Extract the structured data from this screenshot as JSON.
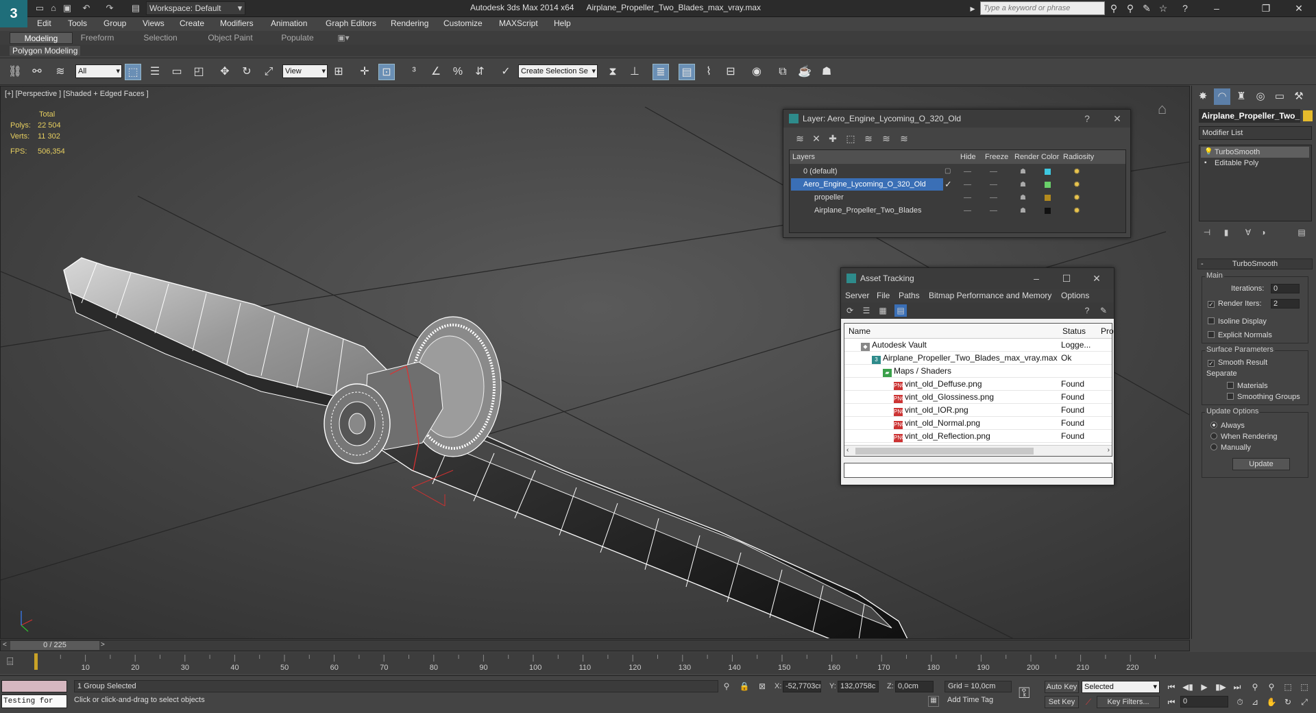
{
  "title_bar": {
    "logo": "3",
    "workspace": "Workspace: Default",
    "app_title": "Autodesk 3ds Max  2014 x64",
    "file_name": "Airplane_Propeller_Two_Blades_max_vray.max",
    "search_placeholder": "Type a keyword or phrase"
  },
  "menu": [
    "Edit",
    "Tools",
    "Group",
    "Views",
    "Create",
    "Modifiers",
    "Animation",
    "Graph Editors",
    "Rendering",
    "Customize",
    "MAXScript",
    "Help"
  ],
  "ribbon": {
    "tabs": [
      "Modeling",
      "Freeform",
      "Selection",
      "Object Paint",
      "Populate"
    ],
    "active_tab": "Modeling",
    "panel_label": "Polygon Modeling"
  },
  "toolbar": {
    "filter": "All",
    "ref_coord": "View",
    "selection_set": "Create Selection Se"
  },
  "viewport": {
    "label": "[+] [Perspective ] [Shaded + Edged Faces ]",
    "stats": {
      "header": "Total",
      "polys_label": "Polys:",
      "polys": "22 504",
      "verts_label": "Verts:",
      "verts": "11 302",
      "fps_label": "FPS:",
      "fps": "506,354"
    }
  },
  "layer_dialog": {
    "title": "Layer: Aero_Engine_Lycoming_O_320_Old",
    "columns": [
      "Layers",
      "Hide",
      "Freeze",
      "Render",
      "Color",
      "Radiosity"
    ],
    "rows": [
      {
        "name": "0 (default)",
        "color": "#3ec8e0"
      },
      {
        "name": "Aero_Engine_Lycoming_O_320_Old",
        "color": "#6ad06a"
      },
      {
        "name": "propeller",
        "color": "#b38a1d"
      },
      {
        "name": "Airplane_Propeller_Two_Blades",
        "color": "#111111"
      }
    ],
    "selected_row": "Aero_Engine_Lycoming_O_320_Old"
  },
  "asset_dialog": {
    "title": "Asset Tracking",
    "menu": [
      "Server",
      "File",
      "Paths",
      "Bitmap Performance and Memory",
      "Options"
    ],
    "columns": [
      "Name",
      "Status",
      "Pro"
    ],
    "rows": [
      {
        "name": "Autodesk Vault",
        "status": "Logge..."
      },
      {
        "name": "Airplane_Propeller_Two_Blades_max_vray.max",
        "status": "Ok"
      },
      {
        "name": "Maps / Shaders",
        "status": ""
      },
      {
        "name": "vint_old_Deffuse.png",
        "status": "Found"
      },
      {
        "name": "vint_old_Glossiness.png",
        "status": "Found"
      },
      {
        "name": "vint_old_IOR.png",
        "status": "Found"
      },
      {
        "name": "vint_old_Normal.png",
        "status": "Found"
      },
      {
        "name": "vint_old_Reflection.png",
        "status": "Found"
      }
    ],
    "png_label": "PNG"
  },
  "command_panel": {
    "object_name": "Airplane_Propeller_Two_",
    "object_color": "#e6bb2c",
    "modifier_list": "Modifier List",
    "stack": [
      "TurboSmooth",
      "Editable Poly"
    ],
    "turbosmooth": {
      "title": "TurboSmooth",
      "main": "Main",
      "iterations_label": "Iterations:",
      "iterations": "0",
      "render_iters_label": "Render Iters:",
      "render_iters": "2",
      "isoline": "Isoline Display",
      "explicit": "Explicit Normals",
      "surface_params": "Surface Parameters",
      "smooth_result": "Smooth Result",
      "separate": "Separate",
      "materials": "Materials",
      "smoothing_groups": "Smoothing Groups",
      "update_options": "Update Options",
      "always": "Always",
      "when_rendering": "When Rendering",
      "manually": "Manually",
      "update_button": "Update"
    }
  },
  "timeline": {
    "slider": "0 / 225",
    "ticks": [
      "10",
      "20",
      "30",
      "40",
      "50",
      "60",
      "70",
      "80",
      "90",
      "100",
      "110",
      "120",
      "130",
      "140",
      "150",
      "160",
      "170",
      "180",
      "190",
      "200",
      "210",
      "220"
    ]
  },
  "status_bar": {
    "maxscript": "Testing for",
    "selected": "1 Group Selected",
    "prompt": "Click or click-and-drag to select objects",
    "x_label": "X:",
    "x": "-52,7703cr",
    "y_label": "Y:",
    "y": "132,0758c",
    "z_label": "Z:",
    "z": "0,0cm",
    "grid": "Grid = 10,0cm",
    "auto_key": "Auto Key",
    "set_key": "Set Key",
    "selected_dropdown": "Selected",
    "key_filters": "Key Filters...",
    "add_time_tag": "Add Time Tag",
    "frame": "0"
  }
}
